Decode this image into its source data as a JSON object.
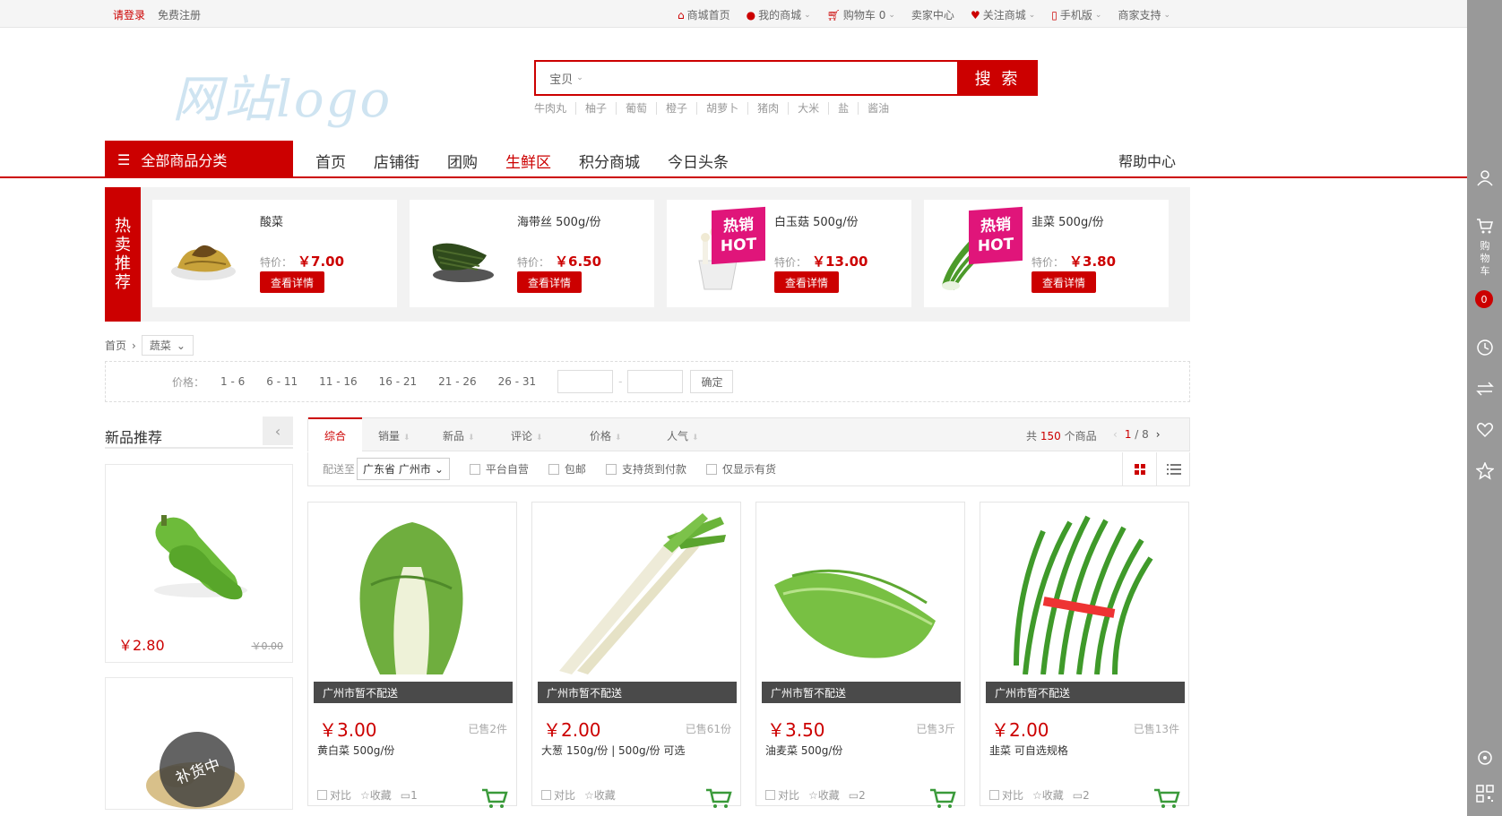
{
  "topbar": {
    "login": "请登录",
    "register": "免费注册",
    "links": [
      {
        "label": "商城首页",
        "icon": "home-icon"
      },
      {
        "label": "我的商城",
        "icon": "user-icon"
      },
      {
        "label": "购物车 0",
        "icon": "cart-icon"
      },
      {
        "label": "卖家中心",
        "icon": ""
      },
      {
        "label": "关注商城",
        "icon": "heart-icon"
      },
      {
        "label": "手机版",
        "icon": "mobile-icon"
      },
      {
        "label": "商家支持",
        "icon": ""
      }
    ]
  },
  "logo": {
    "text": "网站logo"
  },
  "search": {
    "category": "宝贝",
    "value": "",
    "button": "搜 索",
    "hotwords": [
      "牛肉丸",
      "柚子",
      "葡萄",
      "橙子",
      "胡萝卜",
      "猪肉",
      "大米",
      "盐",
      "酱油"
    ]
  },
  "nav": {
    "all_categories": "全部商品分类",
    "items": [
      "首页",
      "店铺街",
      "团购",
      "生鲜区",
      "积分商城",
      "今日头条"
    ],
    "active": "生鲜区",
    "help": "帮助中心"
  },
  "hot": {
    "tag": [
      "热",
      "卖",
      "推",
      "荐"
    ],
    "price_label": "特价：",
    "detail_label": "查看详情",
    "badge": [
      "热销",
      "HOT"
    ],
    "items": [
      {
        "name": "酸菜",
        "price": "￥7.00",
        "hot": false
      },
      {
        "name": "海带丝 500g/份",
        "price": "￥6.50",
        "hot": false
      },
      {
        "name": "白玉菇 500g/份",
        "price": "￥13.00",
        "hot": true
      },
      {
        "name": "韭菜 500g/份",
        "price": "￥3.80",
        "hot": true
      }
    ]
  },
  "breadcrumb": {
    "home": "首页",
    "current": "蔬菜"
  },
  "price_filter": {
    "label": "价格：",
    "ranges": [
      "1 - 6",
      "6 - 11",
      "11 - 16",
      "16 - 21",
      "21 - 26",
      "26 - 31"
    ],
    "separator": "-",
    "confirm": "确定"
  },
  "new_products": {
    "title": "新品推荐",
    "items": [
      {
        "price": "￥2.80",
        "old_price": "￥0.00"
      },
      {
        "overlay": "补货中"
      }
    ]
  },
  "sort": {
    "items": [
      "综合",
      "销量",
      "新品",
      "评论",
      "价格",
      "人气"
    ],
    "active": "综合",
    "total_prefix": "共",
    "total": "150",
    "total_suffix": "个商品",
    "page_current": "1",
    "page_total": "/ 8"
  },
  "filter": {
    "ship_label": "配送至",
    "region": "广东省 广州市",
    "checks": [
      "平台自营",
      "包邮",
      "支持货到付款",
      "仅显示有货"
    ]
  },
  "products": [
    {
      "ship": "广州市暂不配送",
      "price": "￥3.00",
      "sold": "已售2件",
      "name": "黄白菜 500g/份",
      "comments": "1"
    },
    {
      "ship": "广州市暂不配送",
      "price": "￥2.00",
      "sold": "已售61份",
      "name": "大葱 150g/份 | 500g/份 可选",
      "comments": ""
    },
    {
      "ship": "广州市暂不配送",
      "price": "￥3.50",
      "sold": "已售3斤",
      "name": "油麦菜 500g/份",
      "comments": "2"
    },
    {
      "ship": "广州市暂不配送",
      "price": "￥2.00",
      "sold": "已售13件",
      "name": "韭菜 可自选规格",
      "comments": "2"
    }
  ],
  "product_ops": {
    "compare": "对比",
    "favorite": "收藏"
  },
  "sidebar": {
    "cart_text": [
      "购",
      "物",
      "车"
    ],
    "cart_count": "0"
  },
  "colors": {
    "brand": "#cc0000",
    "hot_badge": "#e0157a"
  }
}
